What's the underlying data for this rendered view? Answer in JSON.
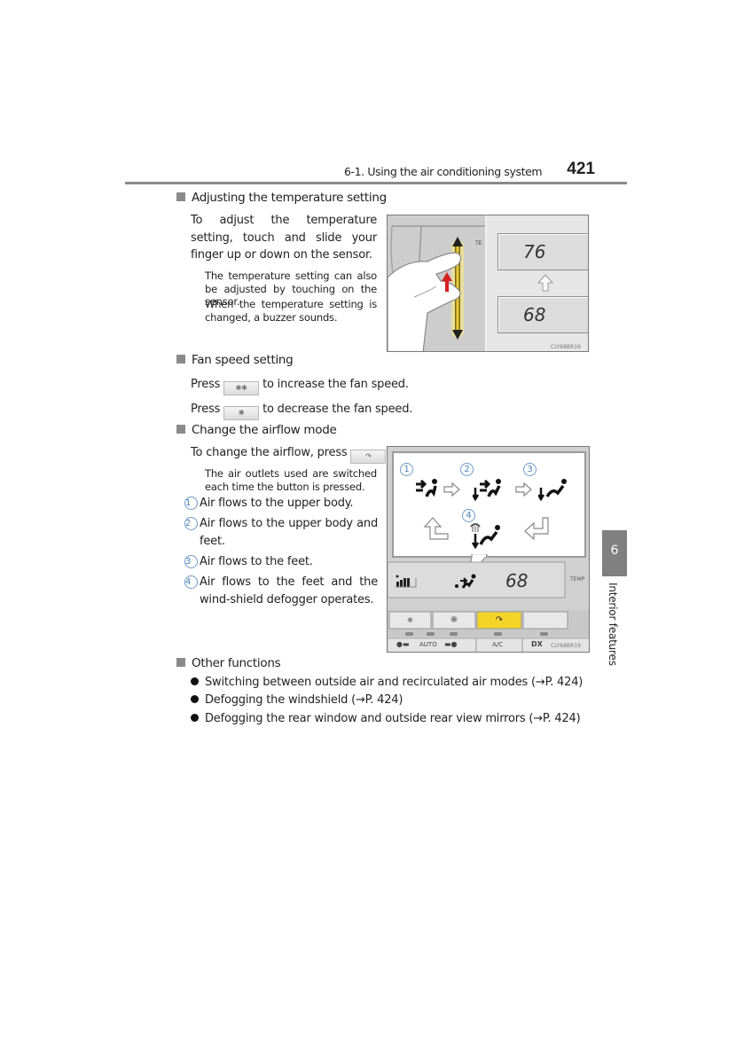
{
  "header": {
    "section": "6-1. Using the air conditioning system",
    "page_number": "421"
  },
  "side_tab": {
    "chapter_number": "6",
    "chapter_title": "Interior features"
  },
  "sections": {
    "temperature": {
      "heading": "Adjusting the temperature setting",
      "body": "To adjust the temperature setting, touch and slide your finger up or down on the sensor.",
      "notes": [
        "The temperature setting can also be adjusted by touching on the sensor.",
        "When the temperature setting is changed, a buzzer sounds."
      ]
    },
    "fan": {
      "heading": "Fan speed setting",
      "lines": [
        {
          "prefix": "Press",
          "suffix": "to increase the fan speed.",
          "button_icon": "fan-high-icon"
        },
        {
          "prefix": "Press",
          "suffix": "to decrease the fan speed.",
          "button_icon": "fan-low-icon"
        }
      ]
    },
    "airflow": {
      "heading": "Change the airflow mode",
      "body_prefix": "To change the airflow, press",
      "body_suffix": ".",
      "note": "The air outlets used are switched each time the button is pressed.",
      "items": [
        {
          "num": "1",
          "text": "Air flows to the upper body."
        },
        {
          "num": "2",
          "text": "Air flows to the upper body and feet."
        },
        {
          "num": "3",
          "text": "Air flows to the feet."
        },
        {
          "num": "4",
          "text": "Air flows to the feet and the wind-shield defogger operates."
        }
      ]
    },
    "other": {
      "heading": "Other functions",
      "bullets": [
        "Switching between outside air and recirculated air modes (→P. 424)",
        "Defogging the windshield (→P. 424)",
        "Defogging the rear window and outside rear view mirrors (→P. 424)"
      ]
    }
  },
  "figure_temp": {
    "display_top": "76",
    "display_bottom": "68",
    "sensor_label": "TE",
    "code": "CLY68BR16"
  },
  "figure_airflow": {
    "mode_numbers": [
      "1",
      "2",
      "3",
      "4"
    ],
    "display_temp": "68",
    "temp_label": "TEMP",
    "buttons_top": [
      "fan-low",
      "fan-high",
      "airflow-mode",
      ""
    ],
    "buttons_bottom": [
      "",
      "AUTO",
      "",
      "A/C",
      "DX"
    ],
    "active_button": "airflow-mode",
    "active_color": "#f5d42a",
    "code": "CLY68BR19"
  }
}
